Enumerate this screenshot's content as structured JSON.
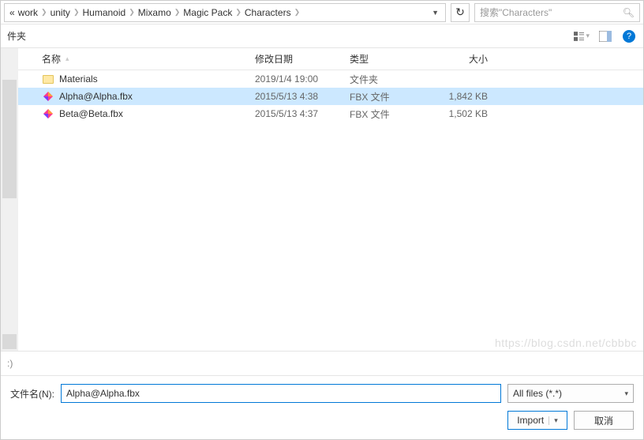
{
  "breadcrumb": {
    "prefix": "«",
    "items": [
      "work",
      "unity",
      "Humanoid",
      "Mixamo",
      "Magic Pack",
      "Characters"
    ]
  },
  "search": {
    "placeholder": "搜索\"Characters\""
  },
  "toolbar": {
    "left_label": "件夹"
  },
  "columns": {
    "name": "名称",
    "date": "修改日期",
    "type": "类型",
    "size": "大小"
  },
  "rows": [
    {
      "icon": "folder",
      "name": "Materials",
      "date": "2019/1/4 19:00",
      "type": "文件夹",
      "size": "",
      "selected": false
    },
    {
      "icon": "fbx",
      "name": "Alpha@Alpha.fbx",
      "date": "2015/5/13 4:38",
      "type": "FBX 文件",
      "size": "1,842 KB",
      "selected": true
    },
    {
      "icon": "fbx",
      "name": "Beta@Beta.fbx",
      "date": "2015/5/13 4:37",
      "type": "FBX 文件",
      "size": "1,502 KB",
      "selected": false
    }
  ],
  "statusbar": {
    "hint": ":)"
  },
  "footer": {
    "filename_label": "文件名(N):",
    "filename_value": "Alpha@Alpha.fbx",
    "filter": "All files (*.*)",
    "import_label": "Import",
    "cancel_label": "取消"
  },
  "watermark": "https://blog.csdn.net/cbbbc"
}
